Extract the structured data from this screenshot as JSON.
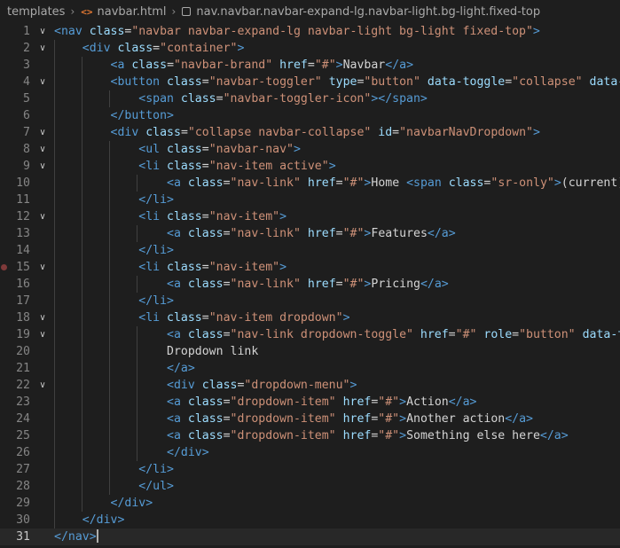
{
  "breadcrumb": {
    "folder": "templates",
    "file": "navbar.html",
    "symbol": "nav.navbar.navbar-expand-lg.navbar-light.bg-light.fixed-top"
  },
  "editor": {
    "current_line": 31,
    "breakpoint_line": 15,
    "colors": {
      "background": "#1e1e1e",
      "tag": "#569cd6",
      "attribute": "#9cdcfe",
      "string": "#ce9178",
      "text": "#d4d4d4",
      "line_number": "#858585"
    },
    "lines": [
      {
        "n": 1,
        "indent": 0,
        "fold": true,
        "tokens": [
          [
            "t",
            "<nav"
          ],
          [
            "a",
            " class"
          ],
          [
            "x",
            "="
          ],
          [
            "s",
            "\"navbar navbar-expand-lg navbar-light bg-light fixed-top\""
          ],
          [
            "t",
            ">"
          ]
        ]
      },
      {
        "n": 2,
        "indent": 1,
        "fold": true,
        "tokens": [
          [
            "t",
            "<div"
          ],
          [
            "a",
            " class"
          ],
          [
            "x",
            "="
          ],
          [
            "s",
            "\"container\""
          ],
          [
            "t",
            ">"
          ]
        ]
      },
      {
        "n": 3,
        "indent": 2,
        "fold": false,
        "tokens": [
          [
            "t",
            "<a"
          ],
          [
            "a",
            " class"
          ],
          [
            "x",
            "="
          ],
          [
            "s",
            "\"navbar-brand\""
          ],
          [
            "a",
            " href"
          ],
          [
            "x",
            "="
          ],
          [
            "s",
            "\"#\""
          ],
          [
            "t",
            ">"
          ],
          [
            "x",
            "Navbar"
          ],
          [
            "t",
            "</a>"
          ]
        ]
      },
      {
        "n": 4,
        "indent": 2,
        "fold": true,
        "tokens": [
          [
            "t",
            "<button"
          ],
          [
            "a",
            " class"
          ],
          [
            "x",
            "="
          ],
          [
            "s",
            "\"navbar-toggler\""
          ],
          [
            "a",
            " type"
          ],
          [
            "x",
            "="
          ],
          [
            "s",
            "\"button\""
          ],
          [
            "a",
            " data-toggle"
          ],
          [
            "x",
            "="
          ],
          [
            "s",
            "\"collapse\""
          ],
          [
            "a",
            " data-ta"
          ]
        ]
      },
      {
        "n": 5,
        "indent": 3,
        "fold": false,
        "tokens": [
          [
            "t",
            "<span"
          ],
          [
            "a",
            " class"
          ],
          [
            "x",
            "="
          ],
          [
            "s",
            "\"navbar-toggler-icon\""
          ],
          [
            "t",
            "></span>"
          ]
        ]
      },
      {
        "n": 6,
        "indent": 2,
        "fold": false,
        "tokens": [
          [
            "t",
            "</button>"
          ]
        ]
      },
      {
        "n": 7,
        "indent": 2,
        "fold": true,
        "tokens": [
          [
            "t",
            "<div"
          ],
          [
            "a",
            " class"
          ],
          [
            "x",
            "="
          ],
          [
            "s",
            "\"collapse navbar-collapse\""
          ],
          [
            "a",
            " id"
          ],
          [
            "x",
            "="
          ],
          [
            "s",
            "\"navbarNavDropdown\""
          ],
          [
            "t",
            ">"
          ]
        ]
      },
      {
        "n": 8,
        "indent": 3,
        "fold": true,
        "tokens": [
          [
            "t",
            "<ul"
          ],
          [
            "a",
            " class"
          ],
          [
            "x",
            "="
          ],
          [
            "s",
            "\"navbar-nav\""
          ],
          [
            "t",
            ">"
          ]
        ]
      },
      {
        "n": 9,
        "indent": 3,
        "fold": true,
        "tokens": [
          [
            "t",
            "<li"
          ],
          [
            "a",
            " class"
          ],
          [
            "x",
            "="
          ],
          [
            "s",
            "\"nav-item active\""
          ],
          [
            "t",
            ">"
          ]
        ]
      },
      {
        "n": 10,
        "indent": 4,
        "fold": false,
        "tokens": [
          [
            "t",
            "<a"
          ],
          [
            "a",
            " class"
          ],
          [
            "x",
            "="
          ],
          [
            "s",
            "\"nav-link\""
          ],
          [
            "a",
            " href"
          ],
          [
            "x",
            "="
          ],
          [
            "s",
            "\"#\""
          ],
          [
            "t",
            ">"
          ],
          [
            "x",
            "Home "
          ],
          [
            "t",
            "<span"
          ],
          [
            "a",
            " class"
          ],
          [
            "x",
            "="
          ],
          [
            "s",
            "\"sr-only\""
          ],
          [
            "t",
            ">"
          ],
          [
            "x",
            "(current)"
          ],
          [
            "t",
            "</"
          ]
        ]
      },
      {
        "n": 11,
        "indent": 3,
        "fold": false,
        "tokens": [
          [
            "t",
            "</li>"
          ]
        ]
      },
      {
        "n": 12,
        "indent": 3,
        "fold": true,
        "tokens": [
          [
            "t",
            "<li"
          ],
          [
            "a",
            " class"
          ],
          [
            "x",
            "="
          ],
          [
            "s",
            "\"nav-item\""
          ],
          [
            "t",
            ">"
          ]
        ]
      },
      {
        "n": 13,
        "indent": 4,
        "fold": false,
        "tokens": [
          [
            "t",
            "<a"
          ],
          [
            "a",
            " class"
          ],
          [
            "x",
            "="
          ],
          [
            "s",
            "\"nav-link\""
          ],
          [
            "a",
            " href"
          ],
          [
            "x",
            "="
          ],
          [
            "s",
            "\"#\""
          ],
          [
            "t",
            ">"
          ],
          [
            "x",
            "Features"
          ],
          [
            "t",
            "</a>"
          ]
        ]
      },
      {
        "n": 14,
        "indent": 3,
        "fold": false,
        "tokens": [
          [
            "t",
            "</li>"
          ]
        ]
      },
      {
        "n": 15,
        "indent": 3,
        "fold": true,
        "tokens": [
          [
            "t",
            "<li"
          ],
          [
            "a",
            " class"
          ],
          [
            "x",
            "="
          ],
          [
            "s",
            "\"nav-item\""
          ],
          [
            "t",
            ">"
          ]
        ]
      },
      {
        "n": 16,
        "indent": 4,
        "fold": false,
        "tokens": [
          [
            "t",
            "<a"
          ],
          [
            "a",
            " class"
          ],
          [
            "x",
            "="
          ],
          [
            "s",
            "\"nav-link\""
          ],
          [
            "a",
            " href"
          ],
          [
            "x",
            "="
          ],
          [
            "s",
            "\"#\""
          ],
          [
            "t",
            ">"
          ],
          [
            "x",
            "Pricing"
          ],
          [
            "t",
            "</a>"
          ]
        ]
      },
      {
        "n": 17,
        "indent": 3,
        "fold": false,
        "tokens": [
          [
            "t",
            "</li>"
          ]
        ]
      },
      {
        "n": 18,
        "indent": 3,
        "fold": true,
        "tokens": [
          [
            "t",
            "<li"
          ],
          [
            "a",
            " class"
          ],
          [
            "x",
            "="
          ],
          [
            "s",
            "\"nav-item dropdown\""
          ],
          [
            "t",
            ">"
          ]
        ]
      },
      {
        "n": 19,
        "indent": 4,
        "fold": true,
        "tokens": [
          [
            "t",
            "<a"
          ],
          [
            "a",
            " class"
          ],
          [
            "x",
            "="
          ],
          [
            "s",
            "\"nav-link dropdown-toggle\""
          ],
          [
            "a",
            " href"
          ],
          [
            "x",
            "="
          ],
          [
            "s",
            "\"#\""
          ],
          [
            "a",
            " role"
          ],
          [
            "x",
            "="
          ],
          [
            "s",
            "\"button\""
          ],
          [
            "a",
            " data-tog"
          ]
        ]
      },
      {
        "n": 20,
        "indent": 4,
        "fold": false,
        "tokens": [
          [
            "x",
            "Dropdown link"
          ]
        ]
      },
      {
        "n": 21,
        "indent": 4,
        "fold": false,
        "tokens": [
          [
            "t",
            "</a>"
          ]
        ]
      },
      {
        "n": 22,
        "indent": 4,
        "fold": true,
        "tokens": [
          [
            "t",
            "<div"
          ],
          [
            "a",
            " class"
          ],
          [
            "x",
            "="
          ],
          [
            "s",
            "\"dropdown-menu\""
          ],
          [
            "t",
            ">"
          ]
        ]
      },
      {
        "n": 23,
        "indent": 4,
        "fold": false,
        "tokens": [
          [
            "t",
            "<a"
          ],
          [
            "a",
            " class"
          ],
          [
            "x",
            "="
          ],
          [
            "s",
            "\"dropdown-item\""
          ],
          [
            "a",
            " href"
          ],
          [
            "x",
            "="
          ],
          [
            "s",
            "\"#\""
          ],
          [
            "t",
            ">"
          ],
          [
            "x",
            "Action"
          ],
          [
            "t",
            "</a>"
          ]
        ]
      },
      {
        "n": 24,
        "indent": 4,
        "fold": false,
        "tokens": [
          [
            "t",
            "<a"
          ],
          [
            "a",
            " class"
          ],
          [
            "x",
            "="
          ],
          [
            "s",
            "\"dropdown-item\""
          ],
          [
            "a",
            " href"
          ],
          [
            "x",
            "="
          ],
          [
            "s",
            "\"#\""
          ],
          [
            "t",
            ">"
          ],
          [
            "x",
            "Another action"
          ],
          [
            "t",
            "</a>"
          ]
        ]
      },
      {
        "n": 25,
        "indent": 4,
        "fold": false,
        "tokens": [
          [
            "t",
            "<a"
          ],
          [
            "a",
            " class"
          ],
          [
            "x",
            "="
          ],
          [
            "s",
            "\"dropdown-item\""
          ],
          [
            "a",
            " href"
          ],
          [
            "x",
            "="
          ],
          [
            "s",
            "\"#\""
          ],
          [
            "t",
            ">"
          ],
          [
            "x",
            "Something else here"
          ],
          [
            "t",
            "</a>"
          ]
        ]
      },
      {
        "n": 26,
        "indent": 4,
        "fold": false,
        "tokens": [
          [
            "t",
            "</div>"
          ]
        ]
      },
      {
        "n": 27,
        "indent": 3,
        "fold": false,
        "tokens": [
          [
            "t",
            "</li>"
          ]
        ]
      },
      {
        "n": 28,
        "indent": 3,
        "fold": false,
        "tokens": [
          [
            "t",
            "</ul>"
          ]
        ]
      },
      {
        "n": 29,
        "indent": 2,
        "fold": false,
        "tokens": [
          [
            "t",
            "</div>"
          ]
        ]
      },
      {
        "n": 30,
        "indent": 1,
        "fold": false,
        "tokens": [
          [
            "t",
            "</div>"
          ]
        ]
      },
      {
        "n": 31,
        "indent": 0,
        "fold": false,
        "tokens": [
          [
            "t",
            "</nav>"
          ]
        ]
      }
    ]
  }
}
